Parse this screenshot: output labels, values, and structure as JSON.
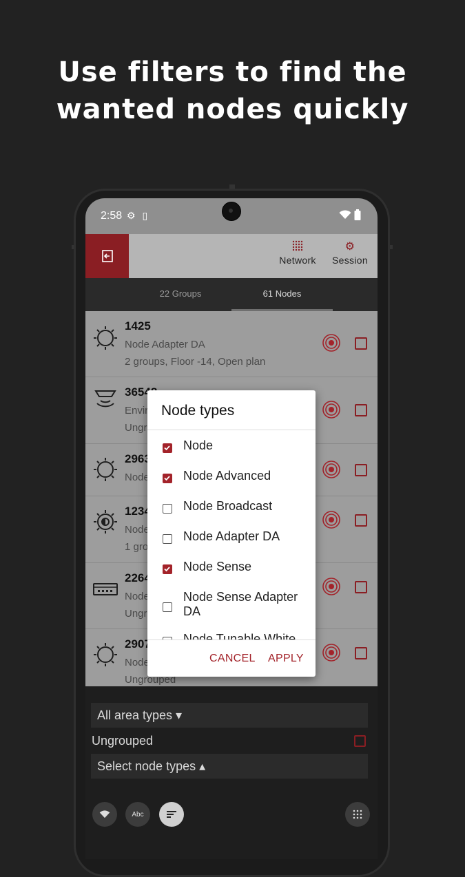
{
  "headline": {
    "line1": "Use filters to find the",
    "line2": "wanted nodes quickly"
  },
  "status_bar": {
    "time": "2:58"
  },
  "app_bar": {
    "network_label": "Network",
    "session_label": "Session"
  },
  "tabs": [
    {
      "label": "22 Groups",
      "active": false
    },
    {
      "label": "61 Nodes",
      "active": true
    }
  ],
  "nodes": [
    {
      "id": "1425",
      "line1": "Node Adapter DA",
      "line2": "2 groups, Floor -14, Open plan",
      "icon": "sun-icon"
    },
    {
      "id": "36548",
      "line1": "Envir",
      "line2": "Ungro",
      "icon": "ceiling-sensor-icon"
    },
    {
      "id": "2963",
      "line1": "Node",
      "line2": "",
      "icon": "sun-icon"
    },
    {
      "id": "1234",
      "line1": "Node",
      "line2": "1 gro",
      "icon": "half-sun-icon"
    },
    {
      "id": "2264",
      "line1": "Node",
      "line2": "Ungro",
      "icon": "box-device-icon"
    },
    {
      "id": "2907",
      "line1": "Node",
      "line2": "Ungrouped",
      "icon": "sun-icon"
    }
  ],
  "dialog": {
    "title": "Node types",
    "options": [
      {
        "label": "Node",
        "checked": true
      },
      {
        "label": "Node Advanced",
        "checked": true
      },
      {
        "label": "Node Broadcast",
        "checked": false
      },
      {
        "label": "Node Adapter DA",
        "checked": false
      },
      {
        "label": "Node Sense",
        "checked": true
      },
      {
        "label": "Node Sense Adapter DA",
        "checked": false
      },
      {
        "label": "Node Tunable White",
        "checked": false
      }
    ],
    "cancel_label": "CANCEL",
    "apply_label": "APPLY"
  },
  "filters": {
    "area_types": "All area types ▾",
    "ungrouped_label": "Ungrouped",
    "node_types": "Select node types ▴"
  },
  "bottom_bar": {
    "abc_label": "Abc"
  },
  "colors": {
    "accent": "#a3232a",
    "app_bar": "#b5b5b5",
    "background": "#222222"
  }
}
